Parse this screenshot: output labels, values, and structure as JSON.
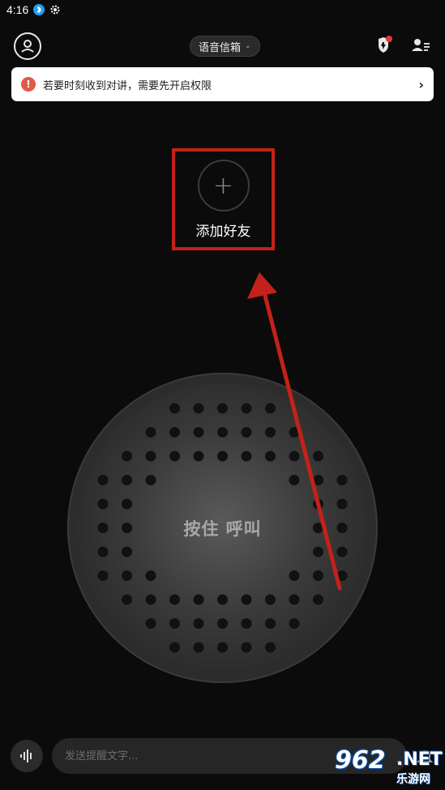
{
  "statusbar": {
    "time": "4:16"
  },
  "header": {
    "mailbox_label": "语音信箱"
  },
  "notice": {
    "text": "若要时刻收到对讲，需要先开启权限",
    "icon_text": "!"
  },
  "add_friend": {
    "label": "添加好友",
    "plus": "+"
  },
  "speaker": {
    "label": "按住 呼叫"
  },
  "composer": {
    "placeholder": "发送提醒文字..."
  },
  "watermark": {
    "number": "962",
    "suffix": ".NET",
    "sub": "乐游网"
  },
  "colors": {
    "highlight_box": "#c3211a",
    "notice_icon": "#e25a45",
    "status_dot": "#1da1f2"
  }
}
